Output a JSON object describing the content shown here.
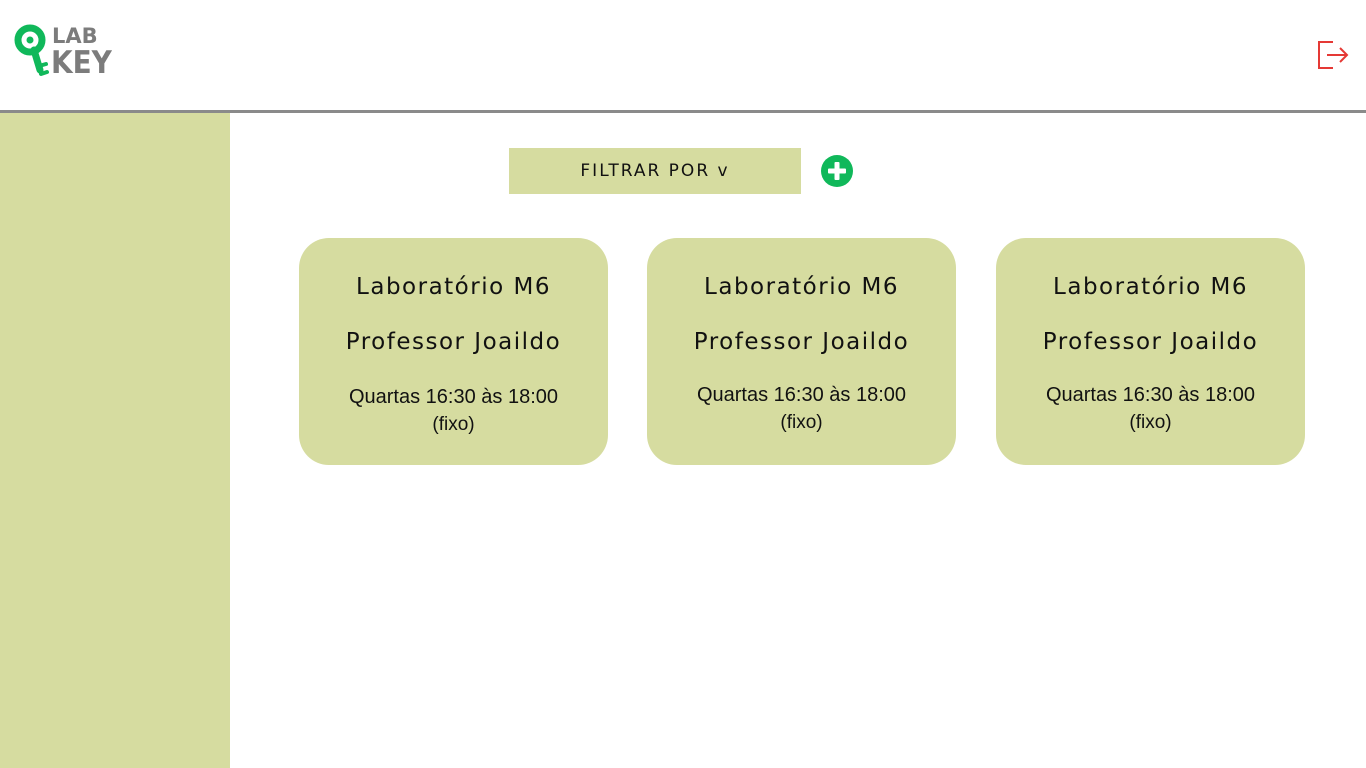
{
  "header": {
    "logo": {
      "line1": "LAB",
      "line2": "KEY"
    },
    "logout_icon": "logout-icon"
  },
  "toolbar": {
    "filter_label": "FILTRAR POR v",
    "add_icon": "plus-circle-icon"
  },
  "colors": {
    "accent_green": "#10b85a",
    "panel": "#d6dca0",
    "logout_red": "#e53935",
    "logo_gray": "#7c7c7c"
  },
  "cards": [
    {
      "lab": "Laboratório M6",
      "professor": "Professor Joaildo",
      "schedule": "Quartas 16:30 às 18:00",
      "note": "(fixo)"
    },
    {
      "lab": "Laboratório M6",
      "professor": "Professor Joaildo",
      "schedule": "Quartas 16:30 às 18:00",
      "note": "(fixo)"
    },
    {
      "lab": "Laboratório M6",
      "professor": "Professor Joaildo",
      "schedule": "Quartas 16:30 às 18:00",
      "note": "(fixo)"
    }
  ]
}
